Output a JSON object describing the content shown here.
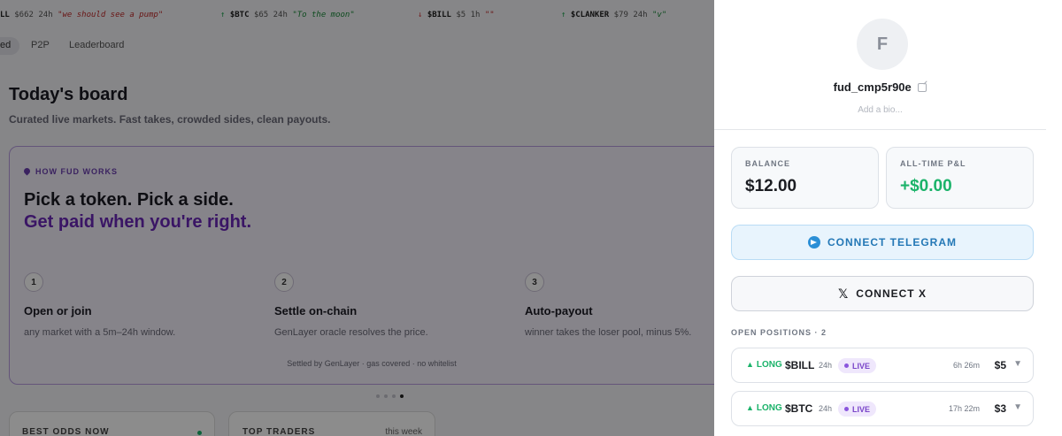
{
  "ticker": [
    {
      "arrow": "",
      "symbol": "LL",
      "amount": "$662",
      "window": "24h",
      "quote": "\"we should see a pump\"",
      "direction": "none"
    },
    {
      "arrow": "↑",
      "symbol": "$BTC",
      "amount": "$65",
      "window": "24h",
      "quote": "\"To the moon\"",
      "direction": "up"
    },
    {
      "arrow": "↓",
      "symbol": "$BILL",
      "amount": "$5",
      "window": "1h",
      "quote": "\"\"",
      "direction": "down"
    },
    {
      "arrow": "↑",
      "symbol": "$CLANKER",
      "amount": "$79",
      "window": "24h",
      "quote": "\"v\"",
      "direction": "up"
    }
  ],
  "nav_tabs": [
    "ed",
    "P2P",
    "Leaderboard"
  ],
  "board": {
    "title": "Today's board",
    "subtitle": "Curated live markets. Fast takes, crowded sides, clean payouts."
  },
  "how": {
    "kicker": "HOW FUD WORKS",
    "headline": "Pick a token. Pick a side.",
    "headline_accent": "Get paid when you're right.",
    "steps": [
      {
        "num": "1",
        "title": "Open or join",
        "desc": "any market with a 5m–24h window."
      },
      {
        "num": "2",
        "title": "Settle on-chain",
        "desc": "GenLayer oracle resolves the price."
      },
      {
        "num": "3",
        "title": "Auto-payout",
        "desc": "winner takes the loser pool, minus 5%."
      }
    ],
    "footer": "Settled by GenLayer · gas covered · no whitelist"
  },
  "carousel": {
    "count": 4,
    "active_index": 3
  },
  "mini_cards": {
    "best_odds": "BEST ODDS NOW",
    "top_traders": "TOP TRADERS",
    "top_traders_period": "this week"
  },
  "profile": {
    "avatar_letter": "F",
    "username": "fud_cmp5r90e",
    "bio_placeholder": "Add a bio...",
    "balance_label": "BALANCE",
    "balance_value": "$12.00",
    "pnl_label": "ALL-TIME P&L",
    "pnl_value": "+$0.00",
    "connect_telegram": "CONNECT TELEGRAM",
    "connect_x": "CONNECT X",
    "x_glyph": "𝕏",
    "positions_label": "OPEN POSITIONS",
    "positions_count": "· 2",
    "positions": [
      {
        "side": "LONG",
        "token": "$BILL",
        "window": "24h",
        "status": "LIVE",
        "time_left": "6h 26m",
        "amount": "$5"
      },
      {
        "side": "LONG",
        "token": "$BTC",
        "window": "24h",
        "status": "LIVE",
        "time_left": "17h 22m",
        "amount": "$3"
      }
    ]
  },
  "colors": {
    "accent_purple": "#6a27b9",
    "profit_green": "#1bb36a",
    "telegram_blue": "#2478b6"
  }
}
